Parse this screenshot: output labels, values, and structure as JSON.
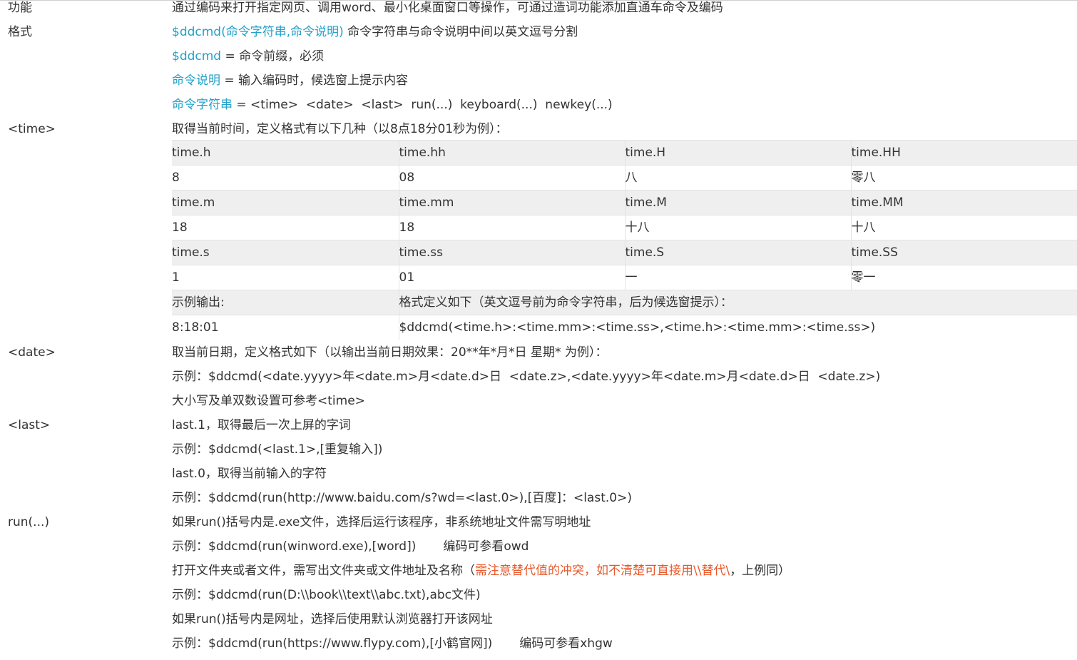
{
  "rows": {
    "func": {
      "label": "功能",
      "text": "通过编码来打开指定网页、调用word、最小化桌面窗口等操作，可通过造词功能添加直通车命令及编码"
    },
    "format": {
      "label": "格式",
      "line1_a": "$ddcmd(命令字符串,命令说明)",
      "line1_b": " 命令字符串与命令说明中间以英文逗号分割",
      "line2_a": "$ddcmd",
      "line2_b": " = 命令前缀，必须",
      "line3_a": "命令说明",
      "line3_b": " = 输入编码时，候选窗上提示内容",
      "line4_a": "命令字符串",
      "line4_b": " = <time>  <date>  <last>  run(...)  keyboard(...)  newkey(...)"
    },
    "time": {
      "label": "<time>",
      "intro": "取得当前时间，定义格式有以下几种（以8点18分01秒为例）：",
      "table": [
        [
          "time.h",
          "time.hh",
          "time.H",
          "time.HH"
        ],
        [
          "8",
          "08",
          "八",
          "零八"
        ],
        [
          "time.m",
          "time.mm",
          "time.M",
          "time.MM"
        ],
        [
          "18",
          "18",
          "十八",
          "十八"
        ],
        [
          "time.s",
          "time.ss",
          "time.S",
          "time.SS"
        ],
        [
          "1",
          "01",
          "一",
          "零一"
        ]
      ],
      "example_header_left": "示例输出:",
      "example_header_right": "格式定义如下（英文逗号前为命令字符串，后为候选窗提示）：",
      "example_output": "8:18:01",
      "example_def": "$ddcmd(<time.h>:<time.mm>:<time.ss>,<time.h>:<time.mm>:<time.ss>)"
    },
    "date": {
      "label": "<date>",
      "line1": "取当前日期，定义格式如下（以输出当前日期效果：20**年*月*日 星期* 为例）：",
      "line2": "示例：$ddcmd(<date.yyyy>年<date.m>月<date.d>日  <date.z>,<date.yyyy>年<date.m>月<date.d>日  <date.z>)",
      "line3": "大小写及单双数设置可参考<time>"
    },
    "last": {
      "label": "<last>",
      "line1": "last.1，取得最后一次上屏的字词",
      "line2": "示例：$ddcmd(<last.1>,[重复输入])",
      "line3": "last.0，取得当前输入的字符",
      "line4": "示例：$ddcmd(run(http://www.baidu.com/s?wd=<last.0>),[百度]：<last.0>)"
    },
    "run": {
      "label": "run(...)",
      "line1": "如果run()括号内是.exe文件，选择后运行该程序，非系统地址文件需写明地址",
      "line2_a": "示例：$ddcmd(run(winword.exe),[word])",
      "line2_b": "编码可参看owd",
      "line3_a": "打开文件夹或者文件，需写出文件夹或文件地址及名称（",
      "line3_b": "需注意替代值的冲突，如不清楚可直接用\\\\替代\\",
      "line3_c": "，上例同）",
      "line4": "示例：$ddcmd(run(D:\\\\book\\\\text\\\\abc.txt),abc文件)",
      "line5": "如果run()括号内是网址，选择后使用默认浏览器打开该网址",
      "line6_a": "示例：$ddcmd(run(https://www.flypy.com),[小鹤官网])",
      "line6_b": "编码可参看xhgw"
    }
  },
  "colors": {
    "accent_blue": "#22a0c8",
    "warning_orange": "#e8582a",
    "text": "#333333",
    "table_shade": "#efefef"
  }
}
